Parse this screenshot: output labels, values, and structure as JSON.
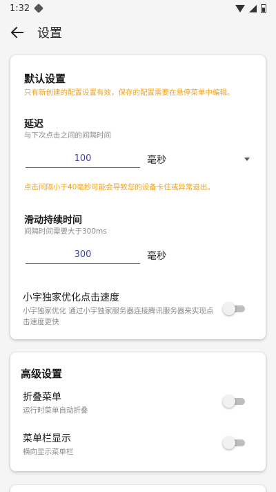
{
  "status_bar": {
    "time": "1:32"
  },
  "header": {
    "title": "设置"
  },
  "default_settings": {
    "title": "默认设置",
    "note": "只有新创建的配置设置有效，保存的配置需要在悬停菜单中编辑。",
    "delay": {
      "label": "延迟",
      "desc": "与下次点击之间的间隔时间",
      "value": "100",
      "unit": "毫秒",
      "warning": "点击间隔小于40毫秒可能会导致您的设备卡住或异常退出。"
    },
    "swipe": {
      "label": "滑动持续时间",
      "desc": "间隔时间需要大于300ms",
      "value": "300",
      "unit": "毫秒"
    },
    "optimize": {
      "label": "小宇独家优化点击速度",
      "desc_line1": "小宇独家优化  通过小宇独家服务器连接腾讯服务器来实现点",
      "desc_line2": "击速度更快",
      "enabled": false
    }
  },
  "advanced_settings": {
    "title": "高级设置",
    "fold_menu": {
      "label": "折叠菜单",
      "desc": "运行时菜单自动折叠",
      "enabled": false
    },
    "menu_bar": {
      "label": "菜单栏显示",
      "desc": "横向显示菜单栏",
      "enabled": false
    }
  },
  "colors": {
    "warning": "#f4a21b",
    "input_text": "#3f3fb0",
    "switch_off_track": "#bdbdbd",
    "switch_off_thumb": "#f1f1f1"
  }
}
